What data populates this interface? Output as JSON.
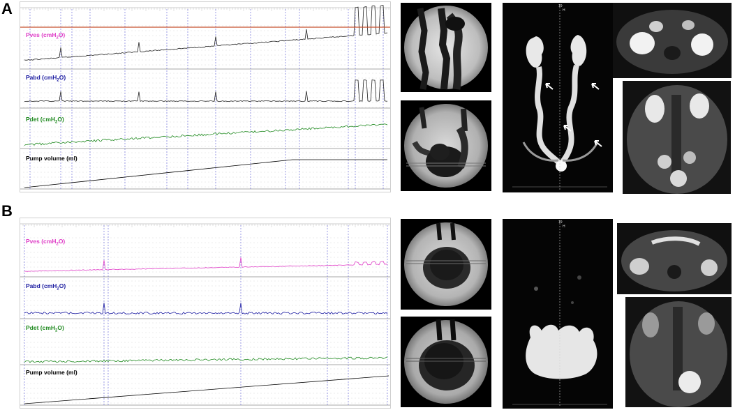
{
  "panels": [
    {
      "letter": "A"
    },
    {
      "letter": "B"
    }
  ],
  "urodynamics": {
    "pves_label": "Pves (cmH",
    "pabd_label": "Pabd (cmH",
    "pdet_label": "Pdet (cmH",
    "subscript_2": "2",
    "o_close": "O)",
    "pump_label": "Pump volume (ml)"
  },
  "mri_marker": {
    "top": "19",
    "sub": "H"
  },
  "colors": {
    "pves": "#e040c8",
    "pabd": "#1a1aa0",
    "pdet": "#1f8a1f",
    "pump": "#000000",
    "event_line": "#5a5ad8",
    "baseline_red": "#c8502d"
  }
}
